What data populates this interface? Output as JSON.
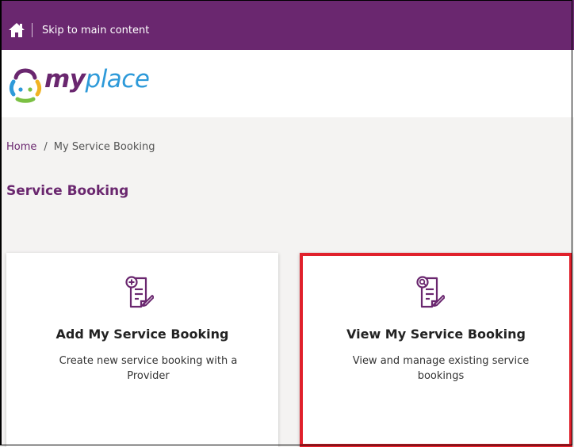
{
  "topbar": {
    "skip_link": "Skip to main content",
    "home_icon": "home-icon",
    "background": "#6a276f"
  },
  "header": {
    "logo": {
      "bold": "my",
      "light": "place"
    }
  },
  "breadcrumb": {
    "home": "Home",
    "separator": "/",
    "current": "My Service Booking"
  },
  "page": {
    "title": "Service Booking"
  },
  "cards": [
    {
      "title": "Add My Service Booking",
      "description": "Create new service booking with a Provider",
      "icon": "add-document-icon"
    },
    {
      "title": "View My Service Booking",
      "description": "View and manage existing service bookings",
      "icon": "search-document-icon",
      "highlight_color": "#e0202b"
    }
  ]
}
